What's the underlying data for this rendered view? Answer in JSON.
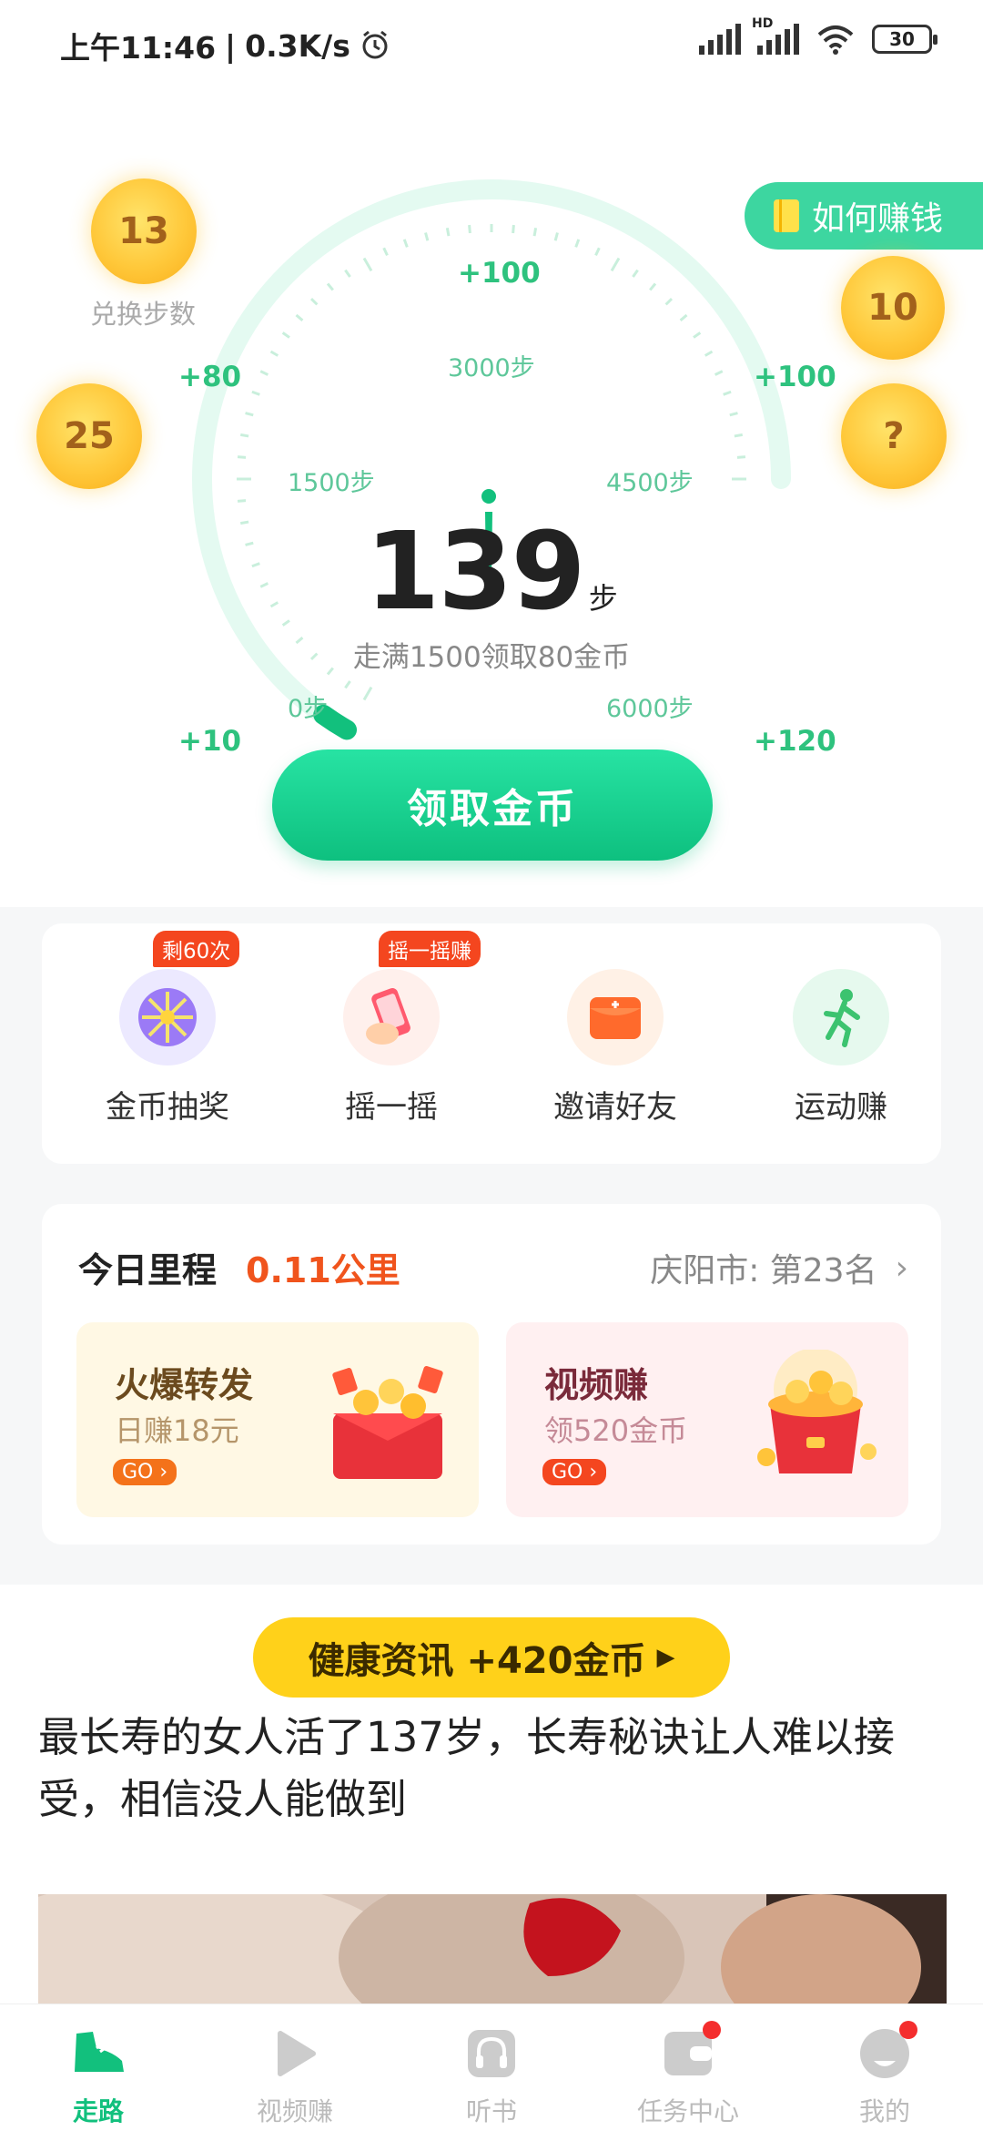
{
  "status_bar": {
    "time": "上午11:46",
    "speed": "0.3K/s",
    "hd_label": "HD",
    "battery": "30"
  },
  "header": {
    "howto_label": "如何赚钱"
  },
  "coins": {
    "exchange_value": "13",
    "exchange_caption": "兑换步数",
    "right_top_value": "10",
    "left_value": "25",
    "right_value": "?"
  },
  "gauge": {
    "outer_labels": [
      "+100",
      "+80",
      "+100",
      "+10",
      "+120"
    ],
    "inner_labels": [
      "3000步",
      "1500步",
      "4500步",
      "0步",
      "6000步"
    ],
    "steps": "139",
    "steps_unit": "步",
    "goal_text": "走满1500领取80金币",
    "progress_fraction": 0.023
  },
  "claim_button": "领取金币",
  "quick_actions": [
    {
      "label": "金币抽奖",
      "badge": "剩60次"
    },
    {
      "label": "摇一摇",
      "badge": "摇一摇赚"
    },
    {
      "label": "邀请好友",
      "badge": ""
    },
    {
      "label": "运动赚",
      "badge": ""
    }
  ],
  "mileage": {
    "title": "今日里程",
    "value": "0.11公里",
    "rank": "庆阳市: 第23名",
    "promos": [
      {
        "title": "火爆转发",
        "subtitle": "日赚18元",
        "go": "GO ›"
      },
      {
        "title": "视频赚",
        "subtitle": "领520金币",
        "go": "GO ›"
      }
    ]
  },
  "news": {
    "pill": "健康资讯 +420金币",
    "headline": "最长寿的女人活了137岁，长寿秘诀让人难以接受，相信没人能做到"
  },
  "tabs": [
    {
      "label": "走路",
      "icon": "shoe-icon"
    },
    {
      "label": "视频赚",
      "icon": "play-icon"
    },
    {
      "label": "听书",
      "icon": "headphones-icon"
    },
    {
      "label": "任务中心",
      "icon": "wallet-icon"
    },
    {
      "label": "我的",
      "icon": "profile-icon"
    }
  ],
  "colors": {
    "accent": "#12c07d",
    "coin": "#ffc83a",
    "badge": "#f4461f",
    "pill": "#ffd11a"
  }
}
